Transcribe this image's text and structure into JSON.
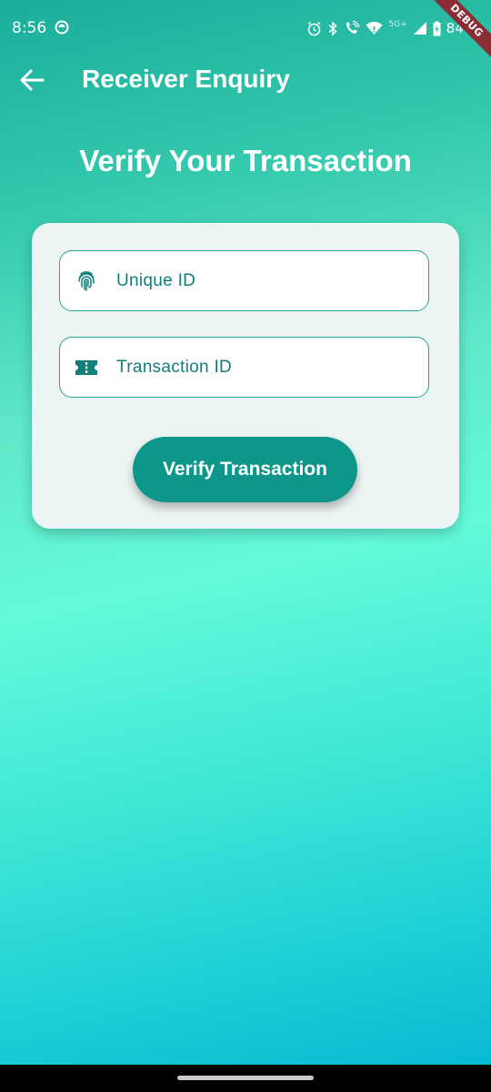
{
  "status_bar": {
    "time": "8:56",
    "network_label": "5G+",
    "battery_text": "84%"
  },
  "debug_banner": "DEBUG",
  "app_bar": {
    "title": "Receiver Enquiry",
    "back_icon": "arrow-back-icon"
  },
  "heading": "Verify Your Transaction",
  "form": {
    "unique_id": {
      "placeholder": "Unique ID",
      "value": "",
      "icon": "fingerprint-icon"
    },
    "transaction_id": {
      "placeholder": "Transaction ID",
      "value": "",
      "icon": "ticket-icon"
    },
    "submit_label": "Verify Transaction"
  },
  "colors": {
    "accent": "#0e968a",
    "field_text": "#0f7f78",
    "field_border": "#2aa395",
    "card_background": "#edf5f4"
  }
}
